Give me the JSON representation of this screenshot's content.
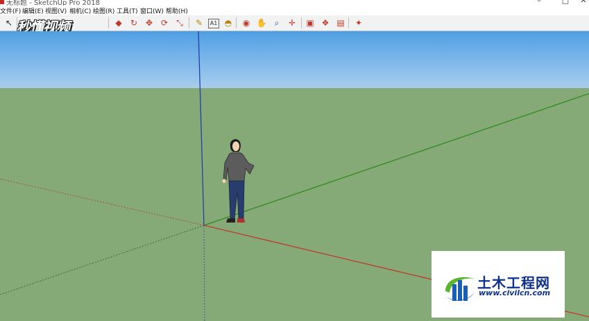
{
  "window": {
    "title": "无标题 - SketchUp Pro 2018",
    "controls": [
      "–",
      "□",
      "✕"
    ]
  },
  "menubar": {
    "items": [
      "文件(F)",
      "编辑(E)",
      "视图(V)",
      "相机(C)",
      "绘图(R)",
      "工具(T)",
      "窗口(W)",
      "帮助(H)"
    ]
  },
  "toolbar": {
    "tools": [
      {
        "name": "select-icon",
        "glyph": "↖",
        "color": "#222222"
      },
      {
        "name": "push-pull-icon",
        "glyph": "◆",
        "color": "#c0392b"
      },
      {
        "name": "follow-me-icon",
        "glyph": "↻",
        "color": "#c0392b"
      },
      {
        "name": "move-icon",
        "glyph": "✥",
        "color": "#c0392b"
      },
      {
        "name": "rotate-icon",
        "glyph": "⟳",
        "color": "#c0392b"
      },
      {
        "name": "scale-icon",
        "glyph": "⤡",
        "color": "#c0392b"
      },
      {
        "name": "tape-measure-icon",
        "glyph": "✎",
        "color": "#b8860b"
      },
      {
        "name": "text-icon",
        "glyph": "A1",
        "color": "#333333"
      },
      {
        "name": "paint-bucket-icon",
        "glyph": "◓",
        "color": "#b8860b"
      },
      {
        "name": "orbit-icon",
        "glyph": "◉",
        "color": "#c0392b"
      },
      {
        "name": "pan-icon",
        "glyph": "✋",
        "color": "#b8860b"
      },
      {
        "name": "zoom-icon",
        "glyph": "⌕",
        "color": "#1f4fa8"
      },
      {
        "name": "zoom-extents-icon",
        "glyph": "✛",
        "color": "#c0392b"
      },
      {
        "name": "warehouse-icon",
        "glyph": "▣",
        "color": "#c0392b"
      },
      {
        "name": "components-icon",
        "glyph": "❖",
        "color": "#c0392b"
      },
      {
        "name": "share-model-icon",
        "glyph": "▤",
        "color": "#c0392b"
      },
      {
        "name": "extension-warehouse-icon",
        "glyph": "✦",
        "color": "#c0392b"
      }
    ]
  },
  "watermark": {
    "text": "秒懂视频"
  },
  "logo": {
    "name": "土木工程网",
    "url": "www.civilcn.com"
  },
  "colors": {
    "sky_top": "#4f9fe4",
    "sky_bottom": "#a8cdee",
    "ground": "#86a978",
    "axis_red": "#c0392b",
    "axis_green": "#2e8b1f",
    "axis_blue": "#1f3fa8"
  }
}
